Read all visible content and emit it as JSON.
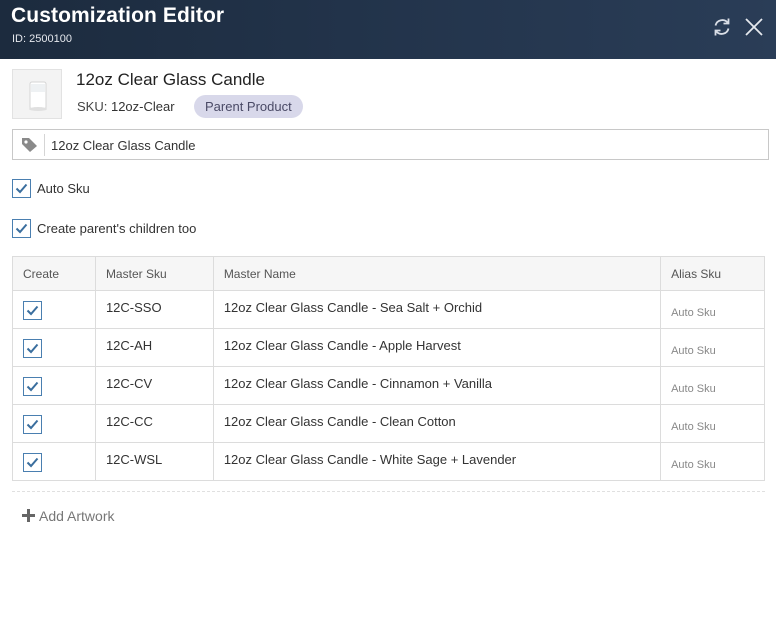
{
  "header": {
    "title": "Customization Editor",
    "id_text": "ID: 2500100"
  },
  "product": {
    "name": "12oz Clear Glass Candle",
    "sku_label": "SKU:",
    "sku_value": "12oz-Clear",
    "badge": "Parent Product",
    "tag_value": "12oz Clear Glass Candle"
  },
  "options": {
    "auto_sku": {
      "label": "Auto Sku",
      "checked": true
    },
    "create_children": {
      "label": "Create parent's children too",
      "checked": true
    }
  },
  "table": {
    "columns": [
      "Create",
      "Master Sku",
      "Master Name",
      "Alias Sku"
    ],
    "rows": [
      {
        "create": true,
        "master_sku": "12C-SSO",
        "master_name": "12oz Clear Glass Candle - Sea Salt + Orchid",
        "alias_sku": "Auto Sku"
      },
      {
        "create": true,
        "master_sku": "12C-AH",
        "master_name": "12oz Clear Glass Candle - Apple Harvest",
        "alias_sku": "Auto Sku"
      },
      {
        "create": true,
        "master_sku": "12C-CV",
        "master_name": "12oz Clear Glass Candle - Cinnamon + Vanilla",
        "alias_sku": "Auto Sku"
      },
      {
        "create": true,
        "master_sku": "12C-CC",
        "master_name": "12oz Clear Glass Candle - Clean Cotton",
        "alias_sku": "Auto Sku"
      },
      {
        "create": true,
        "master_sku": "12C-WSL",
        "master_name": "12oz Clear Glass Candle - White Sage + Lavender",
        "alias_sku": "Auto Sku"
      }
    ]
  },
  "actions": {
    "add_artwork": "Add Artwork"
  },
  "icons": {
    "refresh": "refresh-icon",
    "close": "close-icon",
    "tag": "tag-icon",
    "check": "check-icon",
    "plus": "plus-icon"
  },
  "colors": {
    "header_bg": "#22334a",
    "checkbox_border": "#4a7fb0",
    "badge_bg": "#d8d8ea"
  }
}
